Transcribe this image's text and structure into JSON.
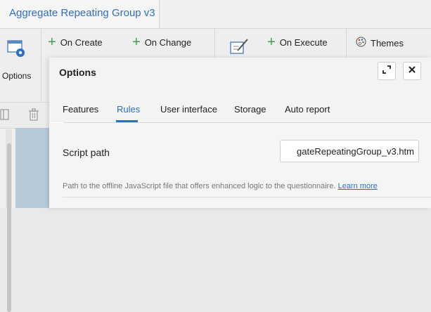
{
  "window": {
    "title": "Aggregate Repeating  Group v3"
  },
  "ribbon": {
    "options_label": "Options",
    "on_create_label": "On Create",
    "on_change_label": "On Change",
    "on_execute_label": "On Execute",
    "themes_label": "Themes"
  },
  "dialog": {
    "title": "Options",
    "tabs": [
      {
        "label": "Features"
      },
      {
        "label": "Rules"
      },
      {
        "label": "User interface"
      },
      {
        "label": "Storage"
      },
      {
        "label": "Auto report"
      }
    ],
    "active_tab": "Rules",
    "script_path": {
      "label": "Script path",
      "value": "gateRepeatingGroup_v3.htm"
    },
    "help_text": "Path to the offline JavaScript file that offers enhanced logic to the questionnaire.",
    "help_link": "Learn more"
  },
  "colors": {
    "accent": "#2d6fc4",
    "plus": "#3ca04a",
    "title": "#2f6fbf"
  }
}
